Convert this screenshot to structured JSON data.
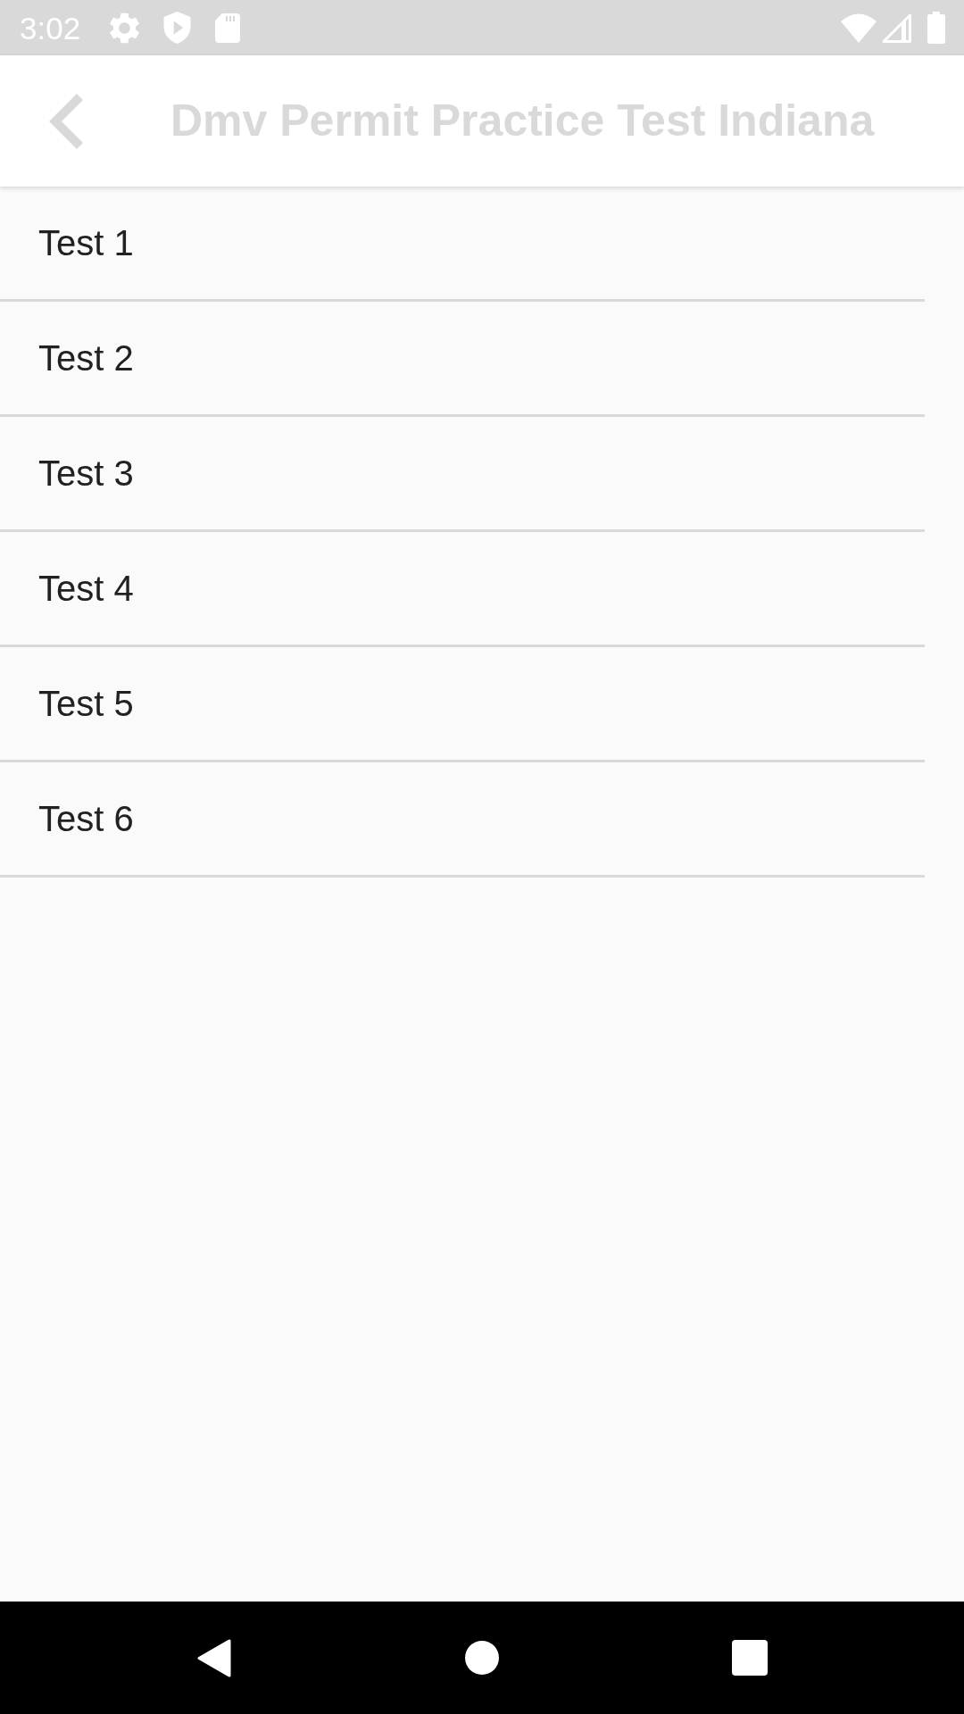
{
  "status_bar": {
    "time": "3:02"
  },
  "app_bar": {
    "title": "Dmv Permit Practice Test Indiana"
  },
  "tests": [
    {
      "label": "Test 1"
    },
    {
      "label": "Test 2"
    },
    {
      "label": "Test 3"
    },
    {
      "label": "Test 4"
    },
    {
      "label": "Test 5"
    },
    {
      "label": "Test 6"
    }
  ]
}
